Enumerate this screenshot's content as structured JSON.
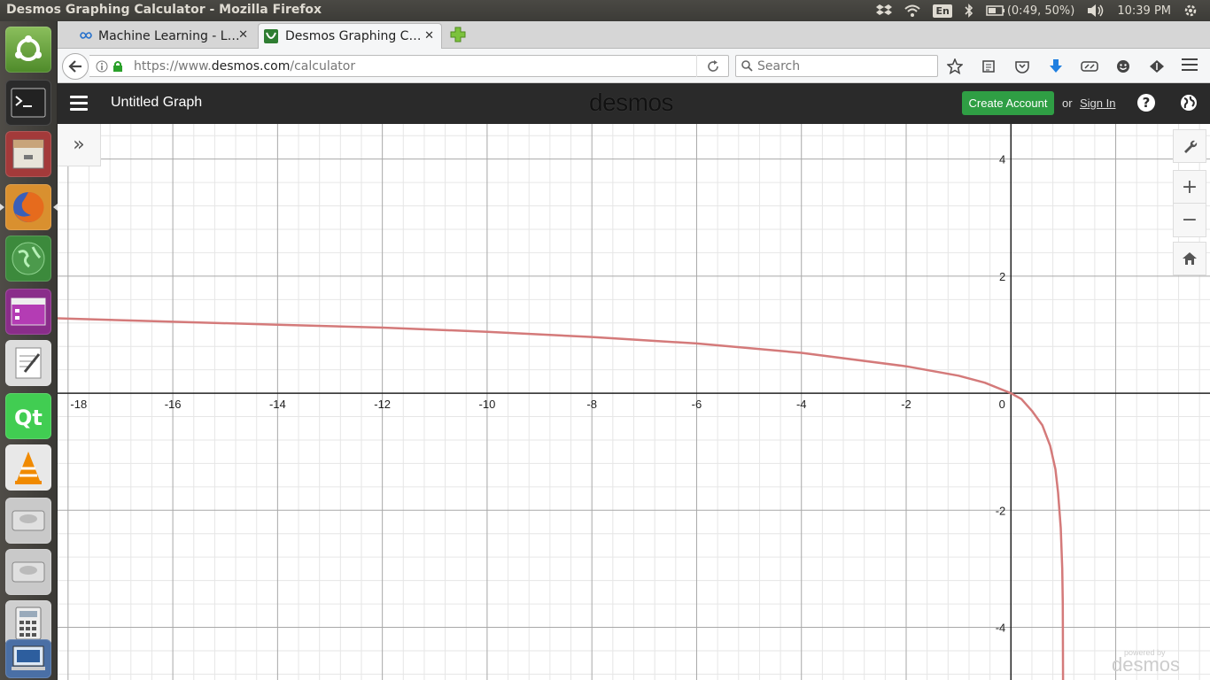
{
  "system": {
    "window_title": "Desmos Graphing Calculator - Mozilla Firefox",
    "keyboard_layout": "En",
    "battery": "(0:49, 50%)",
    "clock": "10:39 PM"
  },
  "browser": {
    "tabs": [
      {
        "label": "Machine Learning - L…",
        "active": false
      },
      {
        "label": "Desmos Graphing C…",
        "active": true
      }
    ],
    "url_prefix": "https://www.",
    "url_domain": "desmos.com",
    "url_path": "/calculator",
    "search_placeholder": "Search"
  },
  "desmos": {
    "graph_title": "Untitled Graph",
    "logo": "desmos",
    "create_account": "Create Account",
    "or_text": "or",
    "sign_in": "Sign In",
    "help": "?",
    "powered_small": "powered by",
    "powered_big": "desmos",
    "expand_glyph": "»",
    "zoom_in": "+",
    "zoom_out": "−",
    "accent": "#2f9e44",
    "curve_color": "#d47a7a"
  },
  "chart_data": {
    "type": "line",
    "xlim": [
      -18.2,
      3.8
    ],
    "ylim": [
      -4.9,
      4.6
    ],
    "grid": true,
    "x_ticks": [
      -18,
      -16,
      -14,
      -12,
      -10,
      -8,
      -6,
      -4,
      -2,
      0
    ],
    "y_ticks": [
      4,
      2,
      -2,
      -4
    ],
    "series": [
      {
        "x": [
          -18.2,
          -16,
          -14,
          -12,
          -10,
          -8,
          -6,
          -4,
          -2,
          -1,
          -0.5,
          0,
          0.2,
          0.4,
          0.6,
          0.75,
          0.85,
          0.9,
          0.95,
          0.98,
          0.99,
          0.995
        ],
        "y": [
          1.28,
          1.22,
          1.17,
          1.12,
          1.05,
          0.96,
          0.85,
          0.69,
          0.46,
          0.3,
          0.18,
          0.0,
          -0.1,
          -0.3,
          -0.55,
          -0.9,
          -1.3,
          -1.7,
          -2.3,
          -3.0,
          -3.6,
          -4.9
        ]
      }
    ]
  }
}
